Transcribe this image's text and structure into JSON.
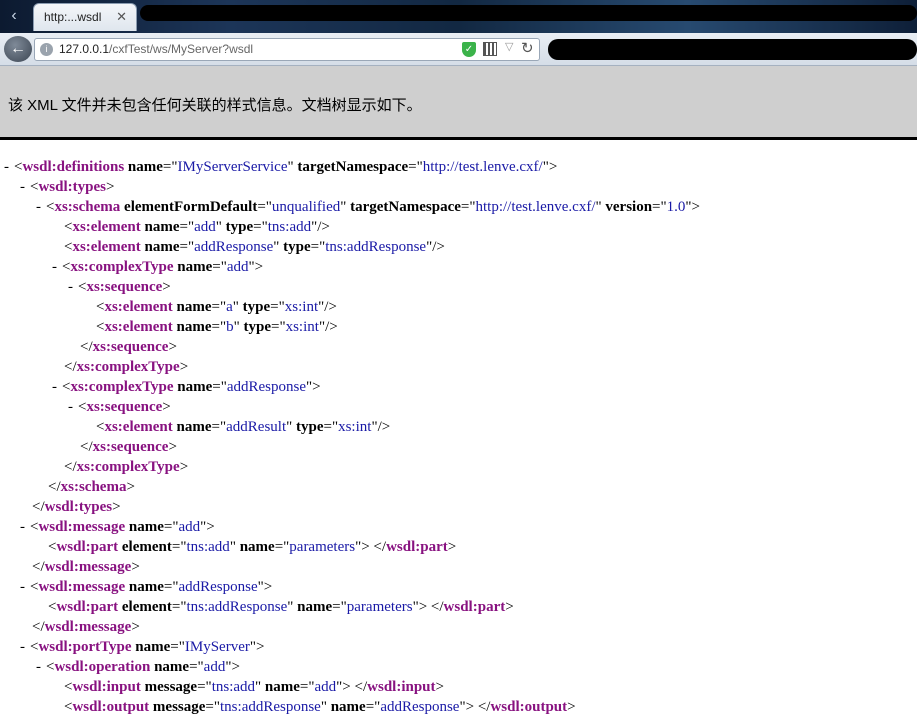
{
  "browser": {
    "tab_title": "http:...wsdl",
    "tab_close": "✕",
    "url_host": "127.0.0.1",
    "url_path": "/cxfTest/ws/MyServer?wsdl"
  },
  "info_message": "该 XML 文件并未包含任何关联的样式信息。文档树显示如下。",
  "xml_lines": [
    {
      "indent": 0,
      "toggle": "-",
      "tag": "wsdl:definitions",
      "open": true,
      "attrs": [
        {
          "name": "name",
          "value": "IMyServerService"
        },
        {
          "name": "targetNamespace",
          "value": "http://test.lenve.cxf/"
        }
      ]
    },
    {
      "indent": 1,
      "toggle": "-",
      "tag": "wsdl:types",
      "open": true,
      "attrs": []
    },
    {
      "indent": 2,
      "toggle": "-",
      "tag": "xs:schema",
      "open": true,
      "attrs": [
        {
          "name": "elementFormDefault",
          "value": "unqualified"
        },
        {
          "name": "targetNamespace",
          "value": "http://test.lenve.cxf/"
        },
        {
          "name": "version",
          "value": "1.0"
        }
      ]
    },
    {
      "indent": 3,
      "toggle": "",
      "tag": "xs:element",
      "self_close": true,
      "attrs": [
        {
          "name": "name",
          "value": "add"
        },
        {
          "name": "type",
          "value": "tns:add"
        }
      ]
    },
    {
      "indent": 3,
      "toggle": "",
      "tag": "xs:element",
      "self_close": true,
      "attrs": [
        {
          "name": "name",
          "value": "addResponse"
        },
        {
          "name": "type",
          "value": "tns:addResponse"
        }
      ]
    },
    {
      "indent": 3,
      "toggle": "-",
      "tag": "xs:complexType",
      "open": true,
      "attrs": [
        {
          "name": "name",
          "value": "add"
        }
      ]
    },
    {
      "indent": 4,
      "toggle": "-",
      "tag": "xs:sequence",
      "open": true,
      "attrs": []
    },
    {
      "indent": 5,
      "toggle": "",
      "tag": "xs:element",
      "self_close": true,
      "attrs": [
        {
          "name": "name",
          "value": "a"
        },
        {
          "name": "type",
          "value": "xs:int"
        }
      ]
    },
    {
      "indent": 5,
      "toggle": "",
      "tag": "xs:element",
      "self_close": true,
      "attrs": [
        {
          "name": "name",
          "value": "b"
        },
        {
          "name": "type",
          "value": "xs:int"
        }
      ]
    },
    {
      "indent": 4,
      "toggle": "",
      "tag": "xs:sequence",
      "close": true
    },
    {
      "indent": 3,
      "toggle": "",
      "tag": "xs:complexType",
      "close": true
    },
    {
      "indent": 3,
      "toggle": "-",
      "tag": "xs:complexType",
      "open": true,
      "attrs": [
        {
          "name": "name",
          "value": "addResponse"
        }
      ]
    },
    {
      "indent": 4,
      "toggle": "-",
      "tag": "xs:sequence",
      "open": true,
      "attrs": []
    },
    {
      "indent": 5,
      "toggle": "",
      "tag": "xs:element",
      "self_close": true,
      "attrs": [
        {
          "name": "name",
          "value": "addResult"
        },
        {
          "name": "type",
          "value": "xs:int"
        }
      ]
    },
    {
      "indent": 4,
      "toggle": "",
      "tag": "xs:sequence",
      "close": true
    },
    {
      "indent": 3,
      "toggle": "",
      "tag": "xs:complexType",
      "close": true
    },
    {
      "indent": 2,
      "toggle": "",
      "tag": "xs:schema",
      "close": true
    },
    {
      "indent": 1,
      "toggle": "",
      "tag": "wsdl:types",
      "close": true
    },
    {
      "indent": 1,
      "toggle": "-",
      "tag": "wsdl:message",
      "open": true,
      "attrs": [
        {
          "name": "name",
          "value": "add"
        }
      ]
    },
    {
      "indent": 2,
      "toggle": "",
      "tag": "wsdl:part",
      "empty_pair": true,
      "attrs": [
        {
          "name": "element",
          "value": "tns:add"
        },
        {
          "name": "name",
          "value": "parameters"
        }
      ]
    },
    {
      "indent": 1,
      "toggle": "",
      "tag": "wsdl:message",
      "close": true
    },
    {
      "indent": 1,
      "toggle": "-",
      "tag": "wsdl:message",
      "open": true,
      "attrs": [
        {
          "name": "name",
          "value": "addResponse"
        }
      ]
    },
    {
      "indent": 2,
      "toggle": "",
      "tag": "wsdl:part",
      "empty_pair": true,
      "attrs": [
        {
          "name": "element",
          "value": "tns:addResponse"
        },
        {
          "name": "name",
          "value": "parameters"
        }
      ]
    },
    {
      "indent": 1,
      "toggle": "",
      "tag": "wsdl:message",
      "close": true
    },
    {
      "indent": 1,
      "toggle": "-",
      "tag": "wsdl:portType",
      "open": true,
      "attrs": [
        {
          "name": "name",
          "value": "IMyServer"
        }
      ]
    },
    {
      "indent": 2,
      "toggle": "-",
      "tag": "wsdl:operation",
      "open": true,
      "attrs": [
        {
          "name": "name",
          "value": "add"
        }
      ]
    },
    {
      "indent": 3,
      "toggle": "",
      "tag": "wsdl:input",
      "empty_pair": true,
      "attrs": [
        {
          "name": "message",
          "value": "tns:add"
        },
        {
          "name": "name",
          "value": "add"
        }
      ]
    },
    {
      "indent": 3,
      "toggle": "",
      "tag": "wsdl:output",
      "empty_pair": true,
      "attrs": [
        {
          "name": "message",
          "value": "tns:addResponse"
        },
        {
          "name": "name",
          "value": "addResponse"
        }
      ]
    }
  ]
}
